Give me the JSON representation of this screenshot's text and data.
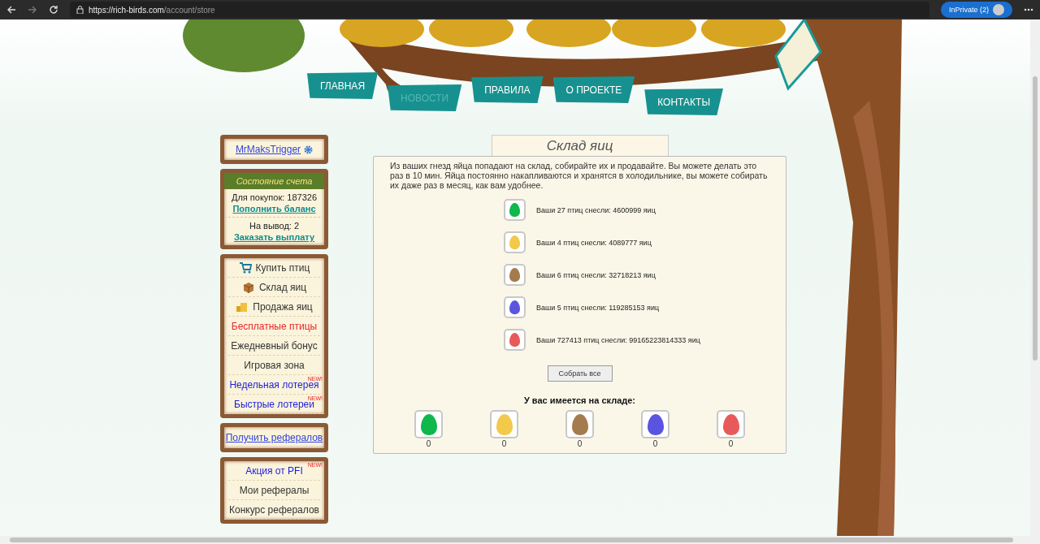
{
  "browser": {
    "url_host": "https://rich-birds.com",
    "url_path": "/account/store",
    "profile": "InPrivate (2)"
  },
  "nav": [
    {
      "label": "ГЛАВНАЯ",
      "dimmed": false
    },
    {
      "label": "НОВОСТИ",
      "dimmed": true
    },
    {
      "label": "ПРАВИЛА",
      "dimmed": false
    },
    {
      "label": "О ПРОЕКТЕ",
      "dimmed": false
    },
    {
      "label": "КОНТАКТЫ",
      "dimmed": false
    }
  ],
  "user": {
    "name": "MrMaksTrigger"
  },
  "account": {
    "title": "Состояние счета",
    "purchase": "Для покупок: 187326",
    "topup": "Пополнить баланс",
    "withdraw": "На вывод: 2",
    "payout": "Заказать выплату"
  },
  "menu": [
    {
      "kind": "cart",
      "label": "Купить птиц",
      "color": "#333333"
    },
    {
      "kind": "box",
      "label": "Склад яиц",
      "color": "#333333"
    },
    {
      "kind": "coins",
      "label": "Продажа яиц",
      "color": "#333333"
    },
    {
      "kind": "plain",
      "label": "Бесплатные птицы",
      "color": "#e8262a"
    },
    {
      "kind": "plain",
      "label": "Ежедневный бонус",
      "color": "#333333"
    },
    {
      "kind": "plain",
      "label": "Игровая зона",
      "color": "#333333"
    },
    {
      "kind": "plain",
      "label": "Недельная лотерея",
      "color": "#1d1ddb",
      "badge": "NEW!"
    },
    {
      "kind": "plain",
      "label": "Быстрые лотереи",
      "color": "#1d1ddb",
      "badge": "NEW!"
    }
  ],
  "referral_link": "Получить рефералов",
  "referral_menu": [
    {
      "label": "Акция от PFI",
      "color": "#1d1ddb",
      "badge": "NEW!"
    },
    {
      "label": "Мои рефералы",
      "color": "#333333"
    },
    {
      "label": "Конкурс рефералов",
      "color": "#333333"
    }
  ],
  "store": {
    "title": "Склад яиц",
    "intro": "Из ваших гнезд яйца попадают на склад, собирайте их и продавайте. Вы можете делать это раз в 10 мин. Яйца постоянно накапливаются и хранятся в холодильнике, вы можете собирать их даже раз в месяц, как вам удобнее.",
    "rows": [
      {
        "color": "#0fb84c",
        "text": "Ваши 27 птиц снесли: 4600999 яиц"
      },
      {
        "color": "#f2c94a",
        "text": "Ваши 4 птиц снесли: 4089777 яиц"
      },
      {
        "color": "#a47b4f",
        "text": "Ваши 6 птиц снесли: 32718213 яиц"
      },
      {
        "color": "#5a55e0",
        "text": "Ваши 5 птиц снесли: 119285153 яиц"
      },
      {
        "color": "#e85a5a",
        "text": "Ваши 727413 птиц снесли: 99165223814333 яиц"
      }
    ],
    "collect_button": "Собрать все",
    "inventory_title": "У вас имеется на складе:",
    "inventory": [
      {
        "color": "#0fb84c",
        "count": "0"
      },
      {
        "color": "#f2c94a",
        "count": "0"
      },
      {
        "color": "#a47b4f",
        "count": "0"
      },
      {
        "color": "#5a55e0",
        "count": "0"
      },
      {
        "color": "#e85a5a",
        "count": "0"
      }
    ]
  }
}
